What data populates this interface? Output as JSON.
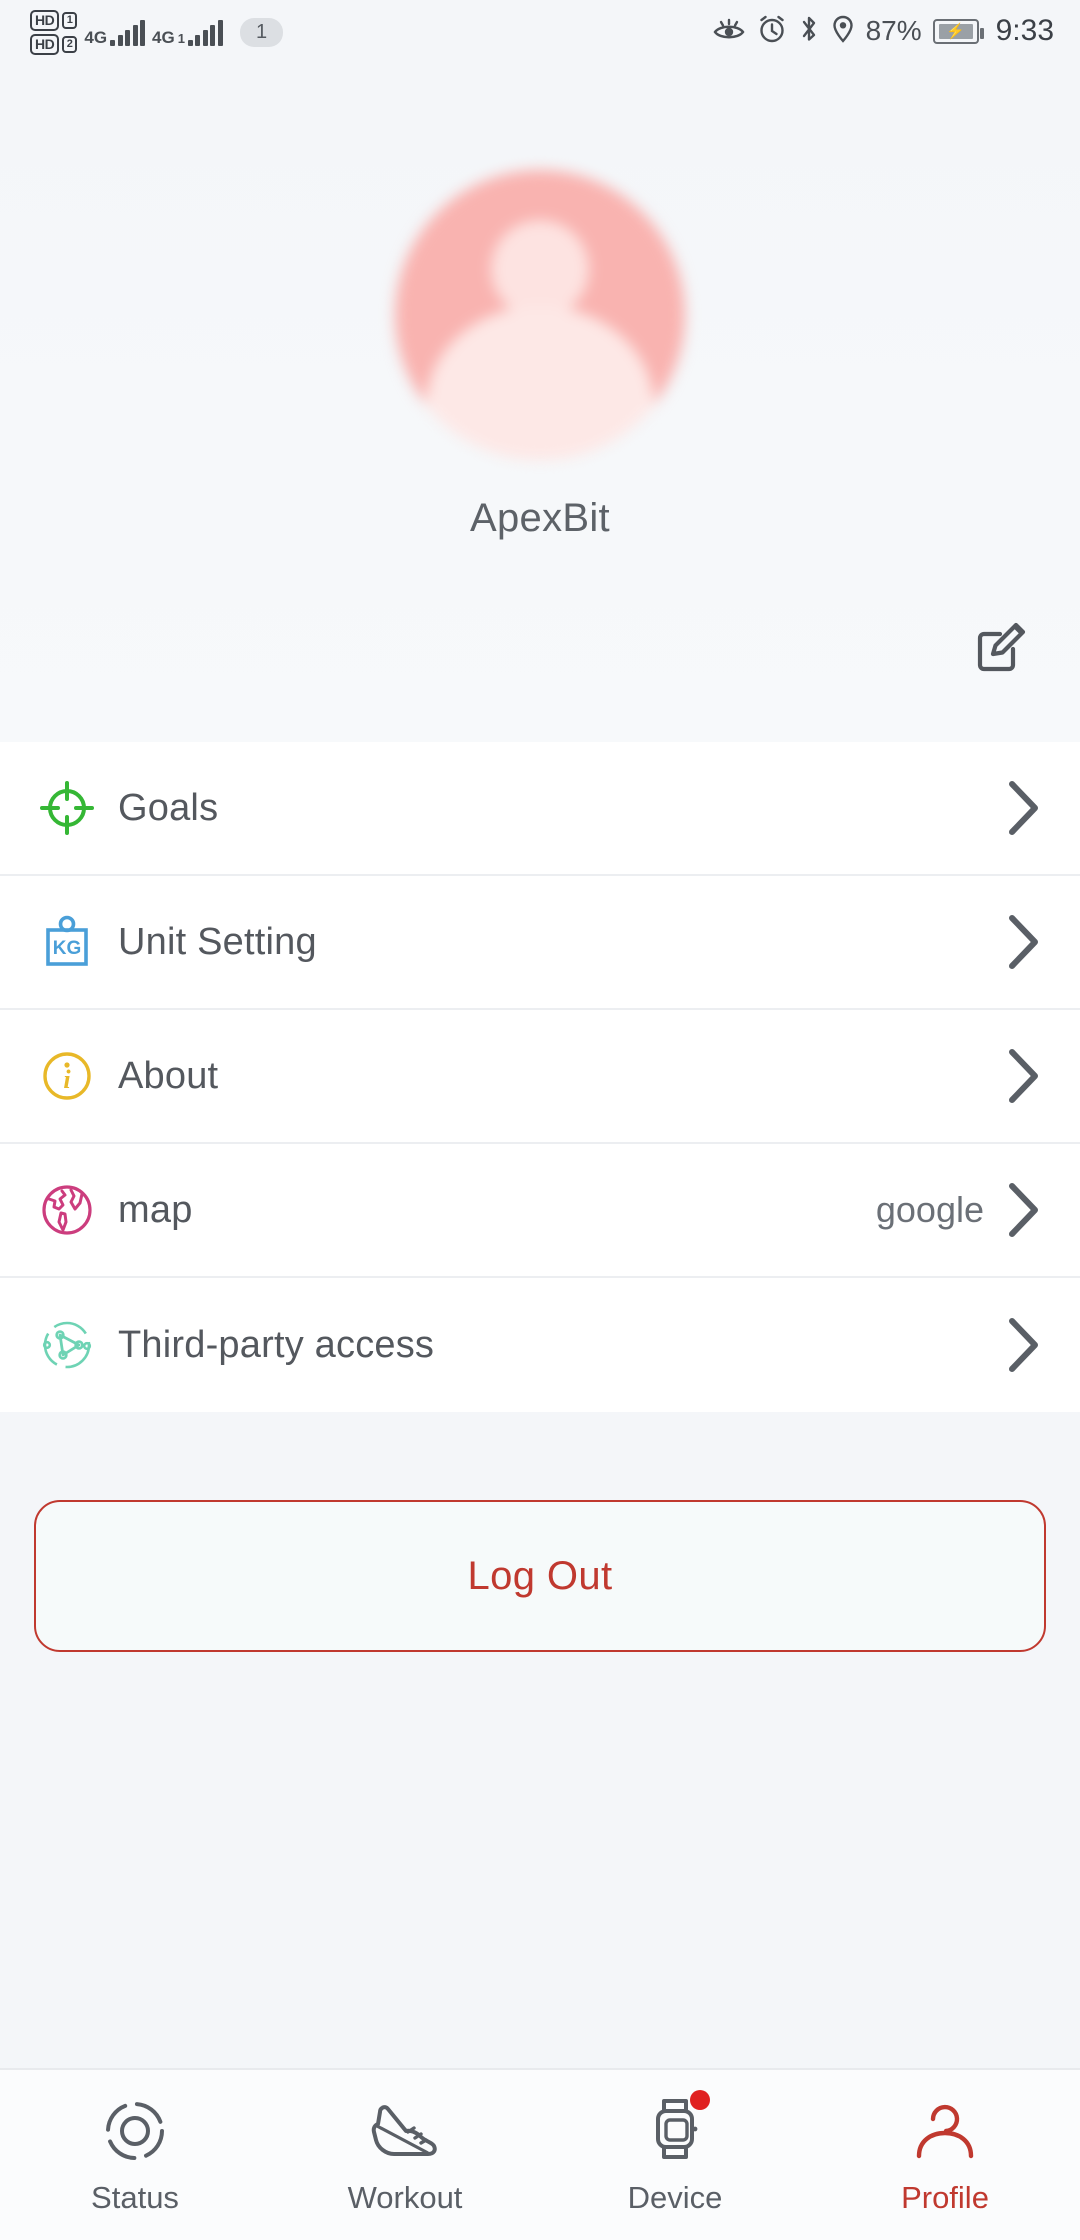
{
  "statusbar": {
    "sim1_hd": "HD",
    "sim1_num": "1",
    "sim2_hd": "HD",
    "sim2_num": "2",
    "net1": "4G",
    "net2": "4G",
    "net2_sub": "1",
    "notification_count": "1",
    "battery_percent": "87%",
    "time": "9:33",
    "icons": [
      "eye-comfort-icon",
      "alarm-icon",
      "bluetooth-icon",
      "location-icon",
      "battery-charging-icon"
    ]
  },
  "profile": {
    "username": "ApexBit",
    "avatar_bg": "#f9b3b0",
    "edit_icon": "edit-square-pencil-icon"
  },
  "settings": {
    "rows": [
      {
        "label": "Goals",
        "value": "",
        "icon": "target-crosshair-icon",
        "color": "#35b735"
      },
      {
        "label": "Unit Setting",
        "value": "",
        "icon": "kg-weight-icon",
        "color": "#4a9fd8"
      },
      {
        "label": "About",
        "value": "",
        "icon": "info-circle-icon",
        "color": "#e8b828"
      },
      {
        "label": "map",
        "value": "google",
        "icon": "globe-icon",
        "color": "#cc3d7e"
      },
      {
        "label": "Third-party access",
        "value": "",
        "icon": "network-share-icon",
        "color": "#6ed3b4"
      }
    ]
  },
  "logout": {
    "label": "Log Out",
    "accent": "#c0392f"
  },
  "bottom_nav": {
    "active_color": "#c0392f",
    "items": [
      {
        "label": "Status",
        "icon": "status-ring-icon",
        "active": false,
        "badge": false
      },
      {
        "label": "Workout",
        "icon": "running-shoe-icon",
        "active": false,
        "badge": false
      },
      {
        "label": "Device",
        "icon": "smartwatch-icon",
        "active": false,
        "badge": true
      },
      {
        "label": "Profile",
        "icon": "person-icon",
        "active": true,
        "badge": false
      }
    ]
  }
}
